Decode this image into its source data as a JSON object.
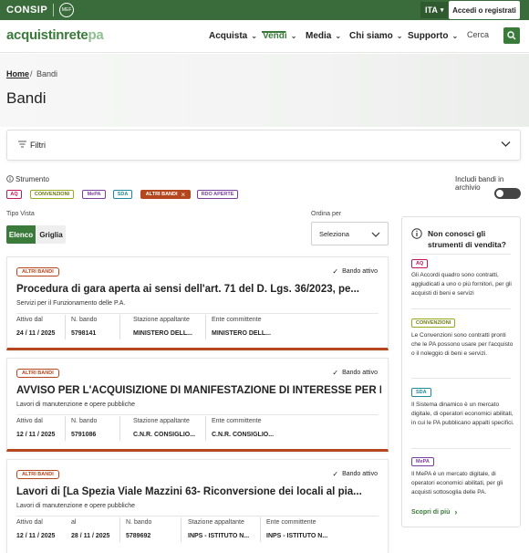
{
  "topbar": {
    "consip": "CONSIP",
    "mef": "MEF",
    "lang": "ITA",
    "login": "Accedi o registrati"
  },
  "header": {
    "logo_main": "acquistinrete",
    "logo_pa": "pa",
    "nav": [
      {
        "label": "Acquista"
      },
      {
        "label": "Vendi",
        "active": true
      },
      {
        "label": "Media"
      },
      {
        "label": "Chi siamo"
      },
      {
        "label": "Supporto"
      }
    ],
    "search_label": "Cerca"
  },
  "breadcrumb": {
    "home": "Home",
    "separator": "/",
    "current": "Bandi"
  },
  "page_title": "Bandi",
  "filters": {
    "label": "Filtri"
  },
  "strumento": {
    "label": "Strumento",
    "tags": [
      {
        "label": "AQ",
        "color": "#c2185b"
      },
      {
        "label": "CONVENZIONI",
        "color": "#9aaa1f"
      },
      {
        "label": "MePA",
        "color": "#7b3fa0"
      },
      {
        "label": "SDA",
        "color": "#1f8a9a"
      },
      {
        "label": "ALTRI BANDI",
        "color": "#b5471e",
        "selected": true,
        "remove_icon": "×"
      },
      {
        "label": "RDO APERTE",
        "color": "#7b3fa0"
      }
    ]
  },
  "archivio": {
    "label": "Includi bandi in archivio",
    "checked": false
  },
  "view": {
    "label": "Tipo Vista",
    "elenco": "Elenco",
    "griglia": "Griglia",
    "selected": "Elenco"
  },
  "sort": {
    "label": "Ordina per",
    "value": "Seleziona"
  },
  "cards": [
    {
      "badge": "ALTRI BANDI",
      "status": "Bando attivo",
      "title": "Procedura di gara aperta ai sensi dell'art. 71 del D. Lgs. 36/2023, pe...",
      "subtitle": "Servizi per il Funzionamento delle P.A.",
      "fields": [
        {
          "label": "Attivo dal",
          "value": "24 / 11 / 2025"
        },
        {
          "label": "N. bando",
          "value": "5798141"
        },
        {
          "label": "Stazione appaltante",
          "value": "MINISTERO DELL..."
        },
        {
          "label": "Ente committente",
          "value": "MINISTERO DELL..."
        }
      ]
    },
    {
      "badge": "ALTRI BANDI",
      "status": "Bando attivo",
      "title": "AVVISO PER L'ACQUISIZIONE DI MANIFESTAZIONE DI INTERESSE PER I LAVO...",
      "subtitle": "Lavori di manutenzione e opere pubbliche",
      "fields": [
        {
          "label": "Attivo dal",
          "value": "12 / 11 / 2025"
        },
        {
          "label": "N. bando",
          "value": "5791086"
        },
        {
          "label": "Stazione appaltante",
          "value": "C.N.R. CONSIGLIO..."
        },
        {
          "label": "Ente committente",
          "value": "C.N.R. CONSIGLIO..."
        }
      ]
    },
    {
      "badge": "ALTRI BANDI",
      "status": "Bando attivo",
      "title": "Lavori di [La Spezia Viale Mazzini 63- Riconversione dei locali al pia...",
      "subtitle": "Lavori di manutenzione e opere pubbliche",
      "fields": [
        {
          "label": "Attivo dal",
          "value": "12 / 11 / 2025"
        },
        {
          "label": "al",
          "value": "28 / 11 / 2025"
        },
        {
          "label": "N. bando",
          "value": "5789692"
        },
        {
          "label": "Stazione appaltante",
          "value": "INPS - ISTITUTO N..."
        },
        {
          "label": "Ente committente",
          "value": "INPS - ISTITUTO N..."
        }
      ]
    }
  ],
  "sidebar": {
    "title": "Non conosci gli strumenti di vendita?",
    "items": [
      {
        "badge": "AQ",
        "color": "#c2185b",
        "text": "Gli Accordi quadro sono contratti, aggiudicati a uno o più fornitori, per gli acquisti di beni e servizi"
      },
      {
        "badge": "CONVENZIONI",
        "color": "#9aaa1f",
        "text": "Le Convenzioni sono contratti pronti che le PA possono usare per l'acquisto o il noleggio di beni e servizi."
      },
      {
        "badge": "SDA",
        "color": "#1f8a9a",
        "text": "Il Sistema dinamico è un mercato digitale, di operatori economici abilitati, in cui le PA pubblicano appalti specifici."
      },
      {
        "badge": "MePA",
        "color": "#7b3fa0",
        "text": "Il MePA è un mercato digitale, di operatori economici abilitati, per gli acquisti sottosoglia delle PA."
      }
    ],
    "more": "Scopri di più"
  }
}
